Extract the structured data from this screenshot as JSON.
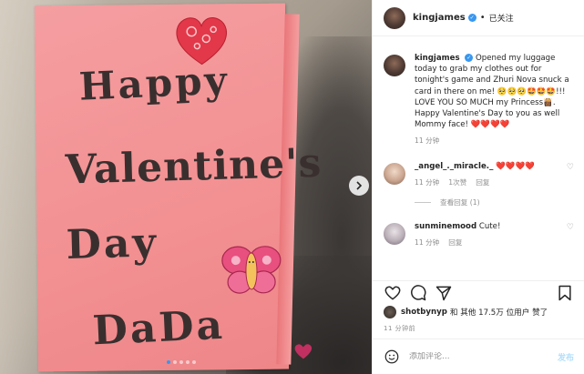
{
  "photo": {
    "card_lines": [
      "Happy",
      "Valentine's",
      "Day",
      "DaDa"
    ],
    "carousel_dots": 5,
    "active_dot": 0,
    "next_icon": "chevron-right-icon"
  },
  "header": {
    "username": "kingjames",
    "separator": "•",
    "follow_label": "已关注"
  },
  "caption": {
    "username": "kingjames",
    "text_part1": "Opened my luggage today to grab my clothes out for tonight's game and Zhuri Nova snuck a card in there on me! ",
    "emojis1": "🥺🥺🥺🤩🤩🤩",
    "text_part2": "!!! LOVE YOU SO MUCH my Princess",
    "emoji_princess": "👸🏾",
    "text_part3": ". Happy Valentine's Day to you as well Mommy face! ",
    "hearts": "❤️❤️❤️❤️",
    "time": "11 分钟"
  },
  "comments": [
    {
      "username": "_angel_._miracle._",
      "text": "❤️❤️❤️❤️",
      "time": "11 分钟",
      "likes": "1次赞",
      "reply": "回复",
      "view_replies": "查看回复 (1)"
    },
    {
      "username": "sunminemood",
      "text": "Cute!",
      "time": "11 分钟",
      "reply": "回复"
    }
  ],
  "likes": {
    "liker": "shotbynyp",
    "rest": "和 其他 17.5万 位用户 赞了"
  },
  "time_ago": "11 分钟前",
  "add_comment": {
    "placeholder": "添加评论...",
    "post_label": "发布"
  },
  "colors": {
    "accent": "#3897f0",
    "card_pink": "#f39294",
    "post_disabled": "#b2dffc"
  }
}
